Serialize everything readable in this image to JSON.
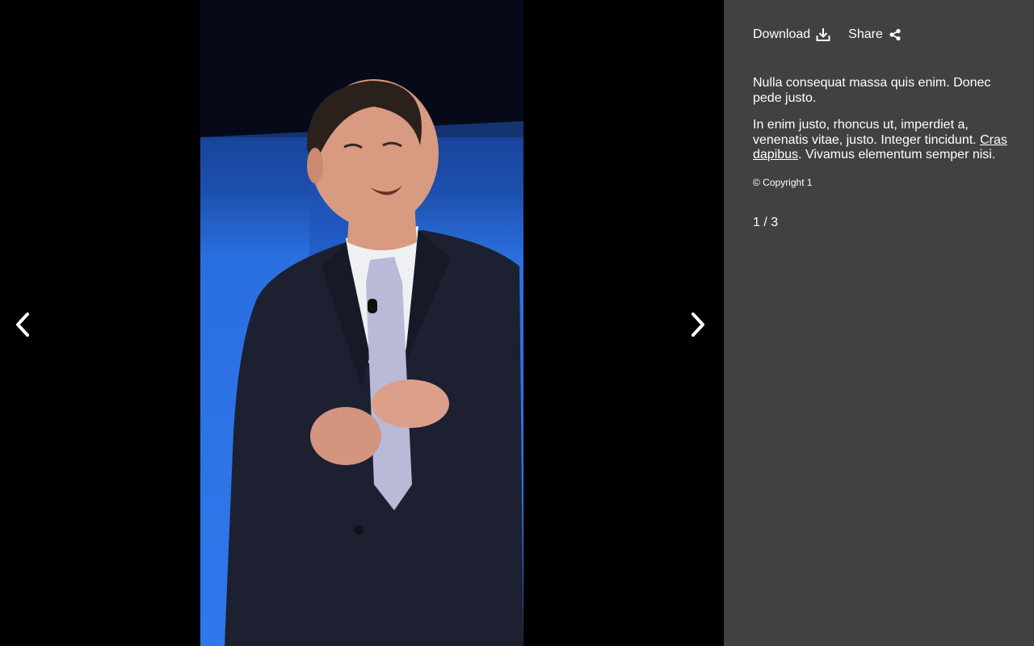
{
  "toolbar": {
    "download_label": "Download",
    "share_label": "Share"
  },
  "icons": {
    "download": "download-icon",
    "share": "share-icon",
    "prev": "chevron-left-icon",
    "next": "chevron-right-icon"
  },
  "caption": {
    "paragraph1": "Nulla consequat massa quis enim. Donec pede justo.",
    "paragraph2_before": "In enim justo, rhoncus ut, imperdiet a, venenatis vitae, justo. Integer tincidunt.",
    "paragraph2_link": "Cras dapibus",
    "paragraph2_after": ". Vivamus elementum semper nisi.",
    "copyright": "© Copyright 1"
  },
  "counter": {
    "current": "1",
    "separator": " / ",
    "total": "3"
  },
  "colors": {
    "panel_bg": "#414141",
    "viewer_bg": "#000000",
    "text": "#ffffff"
  }
}
